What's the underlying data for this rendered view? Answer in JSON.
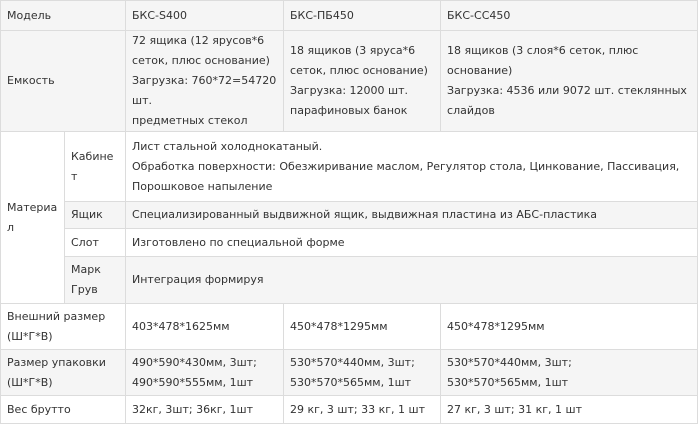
{
  "table": {
    "header": {
      "label": "Модель",
      "col1": "БКС-S400",
      "col2": "БКС-ПБ450",
      "col3": "БКС-СС450"
    },
    "capacity": {
      "label": "Емкость",
      "col1": [
        "72 ящика (12 ярусов*6",
        "сеток, плюс основание)",
        "Загрузка: 760*72=54720 шт.",
        "предметных стекол"
      ],
      "col2": [
        "18 ящиков (3 яруса*6",
        "сеток, плюс основание)",
        "Загрузка: 12000 шт.",
        "парафиновых банок"
      ],
      "col3": [
        "18 ящиков (3 слоя*6 сеток, плюс основание)",
        "Загрузка: 4536 или 9072 шт. стеклянных",
        "слайдов"
      ]
    },
    "material": {
      "label": "Материал",
      "cabinet": {
        "label": "Кабинет",
        "lines": [
          "Лист стальной холоднокатаный.",
          "Обработка поверхности: Обезжиривание маслом, Регулятор стола, Цинкование, Пассивация,",
          "Порошковое напыление"
        ]
      },
      "drawer": {
        "label": "Ящик",
        "value": "Специализированный выдвижной ящик, выдвижная пластина из АБС-пластика"
      },
      "slot": {
        "label": "Слот",
        "value": "Изготовлено по специальной форме"
      },
      "mark": {
        "label": [
          "Марк",
          "Грув"
        ],
        "value": "Интеграция формируя"
      }
    },
    "outer_size": {
      "label": [
        "Внешний размер",
        "(Ш*Г*В)"
      ],
      "col1": "403*478*1625мм",
      "col2": "450*478*1295мм",
      "col3": "450*478*1295мм"
    },
    "package_size": {
      "label": [
        "Размер упаковки",
        "(Ш*Г*В)"
      ],
      "col1": [
        "490*590*430мм, 3шт;",
        "490*590*555мм, 1шт"
      ],
      "col2": [
        "530*570*440мм, 3шт;",
        "530*570*565мм, 1шт"
      ],
      "col3": [
        "530*570*440мм, 3шт;",
        "530*570*565мм, 1шт"
      ]
    },
    "gross_weight": {
      "label": "Вес брутто",
      "col1": "32кг, 3шт; 36кг, 1шт",
      "col2": "29 кг, 3 шт; 33 кг, 1 шт",
      "col3": "27 кг, 3 шт; 31 кг, 1 шт"
    }
  }
}
